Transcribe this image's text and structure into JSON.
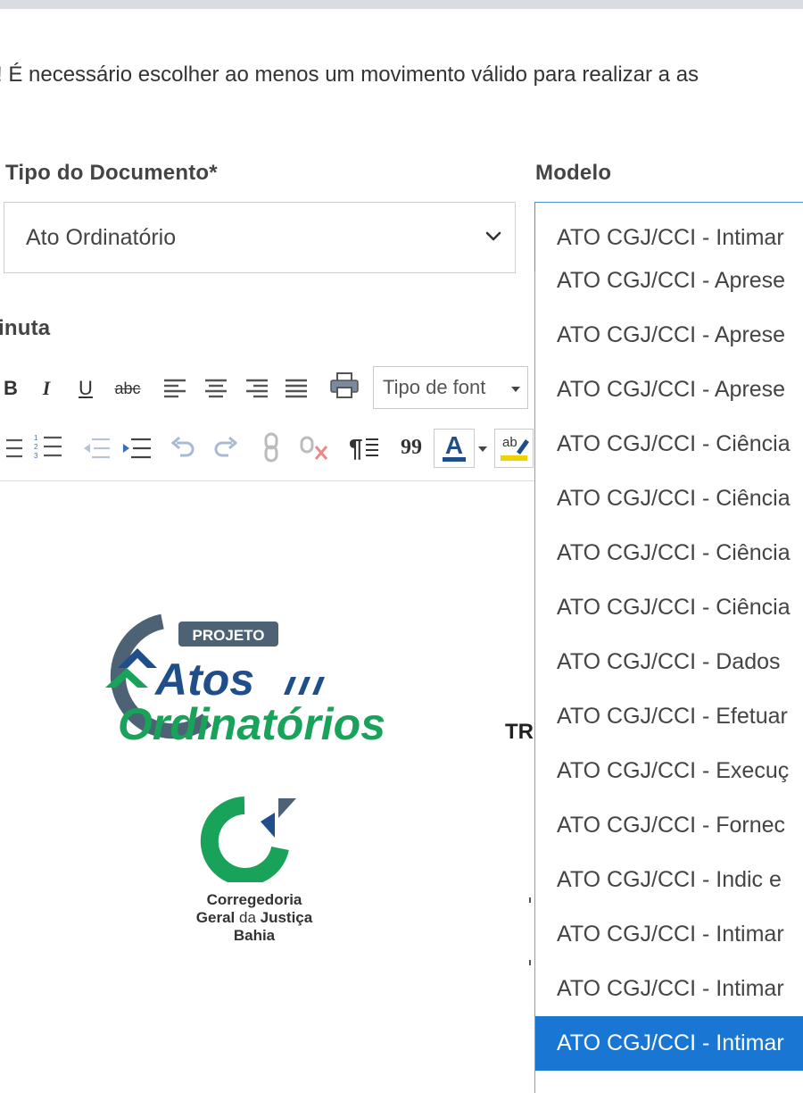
{
  "warning_text": "! É necessário escolher ao menos um movimento válido para realizar a as",
  "tipo_documento": {
    "label": "Tipo do Documento*",
    "value": "Ato Ordinatório"
  },
  "modelo": {
    "label": "Modelo",
    "value": "ATO CGJ/CCI - Intimar",
    "options": [
      "ATO CGJ/CCI - Aprese",
      "ATO CGJ/CCI - Aprese",
      "ATO CGJ/CCI - Aprese",
      "ATO CGJ/CCI - Ciência",
      "ATO CGJ/CCI - Ciência",
      "ATO CGJ/CCI - Ciência",
      "ATO CGJ/CCI - Ciência",
      "ATO CGJ/CCI - Dados",
      "ATO CGJ/CCI - Efetuar",
      "ATO CGJ/CCI - Execuç",
      "ATO CGJ/CCI - Fornec",
      "ATO CGJ/CCI - Indic e",
      "ATO CGJ/CCI - Intimar",
      "ATO CGJ/CCI - Intimar",
      "ATO CGJ/CCI - Intimar"
    ],
    "selected_index": 14
  },
  "minuta": {
    "label": "inuta"
  },
  "toolbar": {
    "bold": "B",
    "italic": "I",
    "underline": "U",
    "strike": "abc",
    "font_select": "Tipo de font",
    "font_color_letter": "A",
    "highlight_letters": "ab",
    "quote": "99"
  },
  "document": {
    "fragment_text": "TR"
  },
  "logos": {
    "projeto_tag": "PROJETO",
    "atos": "Atos",
    "ordinatorios": "Ordinatórios",
    "cgj_line1": "Corregedoria",
    "cgj_line2_a": "Geral ",
    "cgj_line2_b": "da",
    "cgj_line2_c": " Justiça",
    "cgj_line3": "Bahia"
  },
  "colors": {
    "accent_blue": "#1976d2",
    "logo_green": "#18a25a",
    "logo_navy": "#1f4e8a",
    "logo_slate": "#4d6275"
  }
}
